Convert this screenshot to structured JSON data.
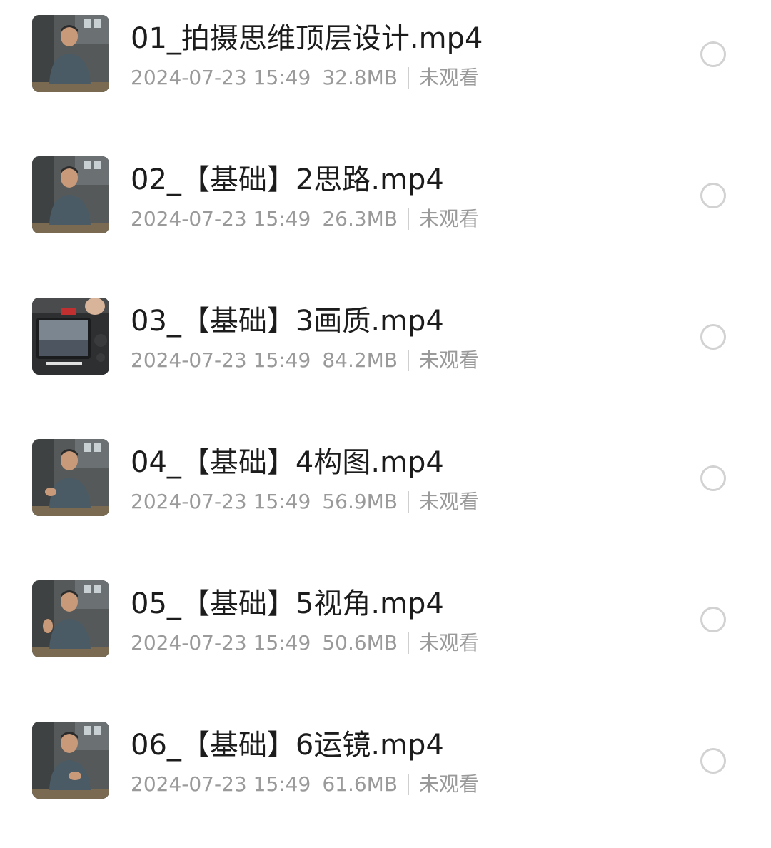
{
  "files": [
    {
      "name": "01_拍摄思维顶层设计.mp4",
      "datetime": "2024-07-23 15:49",
      "size": "32.8MB",
      "status": "未观看",
      "thumb": "person-presenter-icon"
    },
    {
      "name": "02_【基础】2思路.mp4",
      "datetime": "2024-07-23 15:49",
      "size": "26.3MB",
      "status": "未观看",
      "thumb": "person-presenter-icon"
    },
    {
      "name": "03_【基础】3画质.mp4",
      "datetime": "2024-07-23 15:49",
      "size": "84.2MB",
      "status": "未观看",
      "thumb": "camera-screen-icon"
    },
    {
      "name": "04_【基础】4构图.mp4",
      "datetime": "2024-07-23 15:49",
      "size": "56.9MB",
      "status": "未观看",
      "thumb": "person-presenter-icon"
    },
    {
      "name": "05_【基础】5视角.mp4",
      "datetime": "2024-07-23 15:49",
      "size": "50.6MB",
      "status": "未观看",
      "thumb": "person-presenter-icon"
    },
    {
      "name": "06_【基础】6运镜.mp4",
      "datetime": "2024-07-23 15:49",
      "size": "61.6MB",
      "status": "未观看",
      "thumb": "person-presenter-icon"
    }
  ],
  "colors": {
    "title": "#1c1c1c",
    "meta": "#9a9a9a",
    "radio_border": "#d2d2d2",
    "background": "#ffffff"
  }
}
